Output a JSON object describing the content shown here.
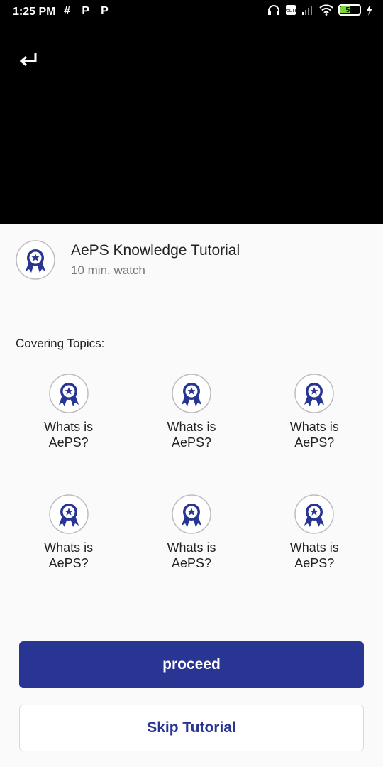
{
  "status_bar": {
    "time": "1:25 PM",
    "app_icons": "# P P",
    "battery": "50"
  },
  "video": {
    "back_icon": "return-arrow-icon"
  },
  "course": {
    "title": "AePS Knowledge Tutorial",
    "duration": "10 min. watch",
    "icon": "award-badge-icon"
  },
  "topics": {
    "heading": "Covering Topics:",
    "items": [
      {
        "label": "Whats is AePS?"
      },
      {
        "label": "Whats is AePS?"
      },
      {
        "label": "Whats is AePS?"
      },
      {
        "label": "Whats is AePS?"
      },
      {
        "label": "Whats is AePS?"
      },
      {
        "label": "Whats is AePS?"
      }
    ]
  },
  "actions": {
    "proceed_label": "proceed",
    "skip_label": "Skip Tutorial"
  },
  "colors": {
    "primary": "#283593",
    "background": "#fafafa",
    "video_bg": "#000000"
  }
}
